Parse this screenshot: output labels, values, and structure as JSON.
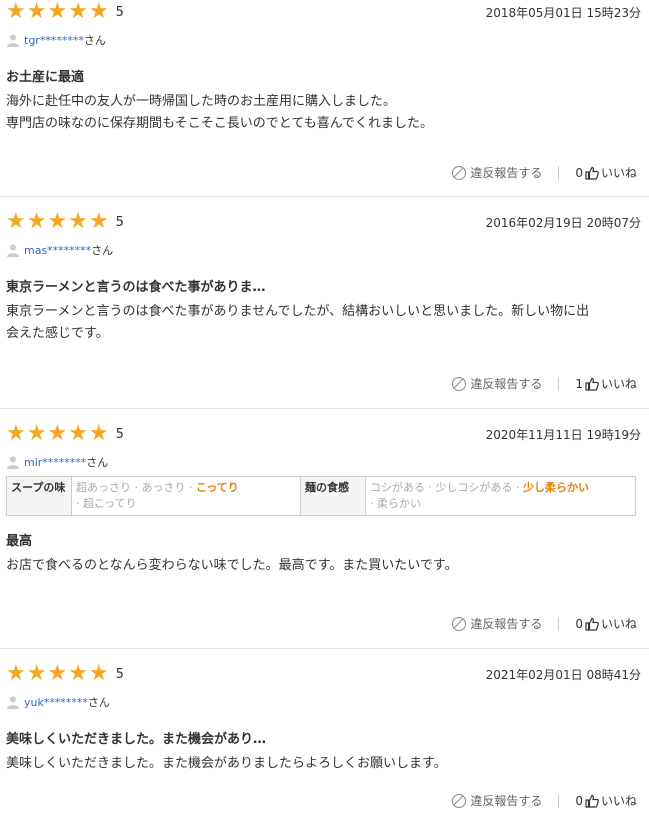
{
  "reviews": [
    {
      "score": "5",
      "date": "2018年05月01日 15時23分",
      "user": "tgr********",
      "suffix": "さん",
      "title": "お土産に最適",
      "body": [
        "海外に赴任中の友人が一時帰国した時のお土産用に購入しました。",
        "専門店の味なのに保存期間もそこそこ長いのでとても喜んでくれました。"
      ],
      "report": "違反報告する",
      "likes": "0",
      "like_label": "いいね"
    },
    {
      "score": "5",
      "date": "2016年02月19日 20時07分",
      "user": "mas********",
      "suffix": "さん",
      "title": "東京ラーメンと言うのは食べた事がありま…",
      "body": [
        "東京ラーメンと言うのは食べた事がありませんでしたが、結構おいしいと思いました。新しい物に出",
        "会えた感じです。"
      ],
      "report": "違反報告する",
      "likes": "1",
      "like_label": "いいね"
    },
    {
      "score": "5",
      "date": "2020年11月11日 19時19分",
      "user": "mir********",
      "suffix": "さん",
      "attrs": {
        "soup_label": "スープの味",
        "soup_opts": [
          "超あっさり",
          "あっさり",
          "こってり",
          "超こってり"
        ],
        "soup_selected": "こってり",
        "noodle_label": "麺の食感",
        "noodle_opts": [
          "コシがある",
          "少しコシがある",
          "少し柔らかい",
          "柔らかい"
        ],
        "noodle_selected": "少し柔らかい"
      },
      "title": "最高",
      "body": [
        "お店で食べるのとなんら変わらない味でした。最高です。また買いたいです。"
      ],
      "report": "違反報告する",
      "likes": "0",
      "like_label": "いいね"
    },
    {
      "score": "5",
      "date": "2021年02月01日 08時41分",
      "user": "yuk********",
      "suffix": "さん",
      "title": "美味しくいただきました。また機会があり…",
      "body": [
        "美味しくいただきました。また機会がありましたらよろしくお願いします。"
      ],
      "report": "違反報告する",
      "likes": "0",
      "like_label": "いいね"
    }
  ]
}
